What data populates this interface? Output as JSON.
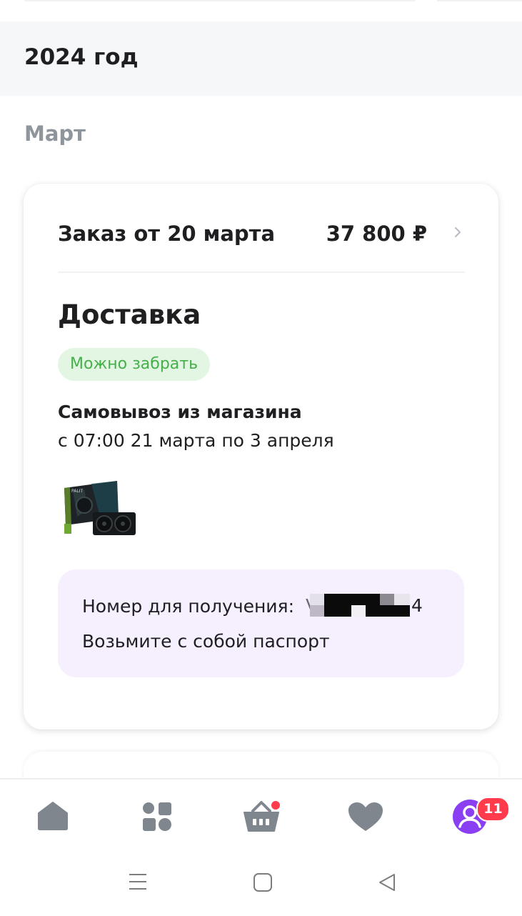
{
  "history": {
    "year_label": "2024 год",
    "month_label": "Март"
  },
  "order": {
    "title": "Заказ от 20 марта",
    "price": "37 800 ₽",
    "delivery_heading": "Доставка",
    "status": "Можно забрать",
    "status_color": "#45b04a",
    "pickup_method": "Самовывоз из магазина",
    "pickup_period": "с 07:00 21 марта по 3 апреля",
    "product_image": "graphics-card-thumbnail",
    "pickup_code_label": "Номер для получения:",
    "pickup_code_visible_prefix": "V",
    "pickup_code_visible_suffix": "4",
    "passport_note": "Возьмите с собой паспорт"
  },
  "bottom_nav": {
    "items": [
      {
        "icon": "home-icon"
      },
      {
        "icon": "catalog-icon"
      },
      {
        "icon": "basket-icon",
        "dot": true
      },
      {
        "icon": "heart-icon"
      },
      {
        "icon": "profile-icon",
        "badge": "11"
      }
    ],
    "accent_color": "#8a3ff2",
    "badge_color": "#ff3b4c"
  },
  "system_nav": {
    "buttons": [
      "recent-apps-icon",
      "home-button-icon",
      "back-icon"
    ]
  }
}
